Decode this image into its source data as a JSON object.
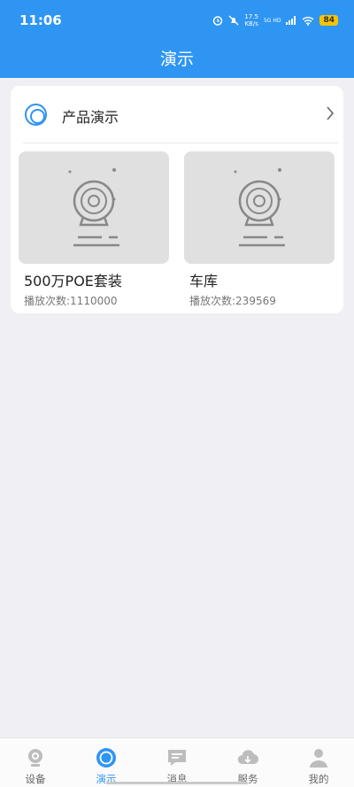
{
  "status": {
    "time": "11:06",
    "net_speed_value": "17.5",
    "net_speed_unit": "KB/s",
    "network": "5G HD",
    "battery": "84"
  },
  "header": {
    "title": "演示"
  },
  "section": {
    "title": "产品演示",
    "icon": "circle-camera-icon",
    "chevron": "chevron-right-icon"
  },
  "items": [
    {
      "name": "500万POE套装",
      "play_count": "播放次数:1110000",
      "thumb_icon": "camera-placeholder-icon"
    },
    {
      "name": "车库",
      "play_count": "播放次数:239569",
      "thumb_icon": "camera-placeholder-icon"
    }
  ],
  "tabs": [
    {
      "label": "设备",
      "icon": "device-camera-icon",
      "active": false
    },
    {
      "label": "演示",
      "icon": "demo-circle-icon",
      "active": true
    },
    {
      "label": "消息",
      "icon": "message-icon",
      "active": false
    },
    {
      "label": "服务",
      "icon": "cloud-service-icon",
      "active": false
    },
    {
      "label": "我的",
      "icon": "profile-icon",
      "active": false
    }
  ],
  "colors": {
    "accent": "#2e95f3",
    "background": "#efeff4",
    "battery": "#f5c400"
  }
}
